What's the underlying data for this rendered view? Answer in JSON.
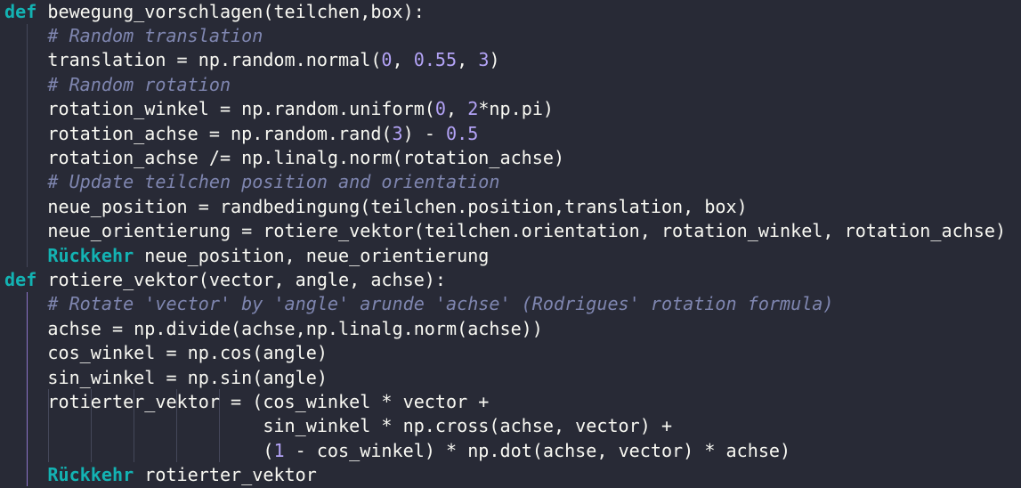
{
  "editor": {
    "lines": [
      [
        {
          "t": "def",
          "c": "kw"
        },
        {
          "t": " bewegung_vorschlagen(teilchen,box):",
          "c": "op"
        }
      ],
      [
        {
          "t": "    "
        },
        {
          "t": "# Random translation",
          "c": "cm"
        }
      ],
      [
        {
          "t": "    translation = np.random.normal("
        },
        {
          "t": "0",
          "c": "num"
        },
        {
          "t": ", "
        },
        {
          "t": "0.55",
          "c": "num"
        },
        {
          "t": ", "
        },
        {
          "t": "3",
          "c": "num"
        },
        {
          "t": ")"
        }
      ],
      [
        {
          "t": "    "
        },
        {
          "t": "# Random rotation",
          "c": "cm"
        }
      ],
      [
        {
          "t": "    rotation_winkel = np.random.uniform("
        },
        {
          "t": "0",
          "c": "num"
        },
        {
          "t": ", "
        },
        {
          "t": "2",
          "c": "num"
        },
        {
          "t": "*np.pi)"
        }
      ],
      [
        {
          "t": "    rotation_achse = np.random.rand("
        },
        {
          "t": "3",
          "c": "num"
        },
        {
          "t": ") - "
        },
        {
          "t": "0.5",
          "c": "num"
        }
      ],
      [
        {
          "t": "    rotation_achse /= np.linalg.norm(rotation_achse)"
        }
      ],
      [
        {
          "t": "    "
        },
        {
          "t": "# Update teilchen position and orientation",
          "c": "cm"
        }
      ],
      [
        {
          "t": "    neue_position = randbedingung(teilchen.position,translation, box)"
        }
      ],
      [
        {
          "t": "    neue_orientierung = rotiere_vektor(teilchen.orientation, rotation_winkel, rotation_achse)"
        }
      ],
      [
        {
          "t": "    "
        },
        {
          "t": "Rückkehr",
          "c": "kw"
        },
        {
          "t": " neue_position, neue_orientierung"
        }
      ],
      [
        {
          "t": "def",
          "c": "kw"
        },
        {
          "t": " rotiere_vektor(vector, angle, achse):"
        }
      ],
      [
        {
          "t": "    "
        },
        {
          "t": "# Rotate 'vector' by 'angle' arunde 'achse' (Rodrigues' rotation formula)",
          "c": "cm"
        }
      ],
      [
        {
          "t": "    achse = np.divide(achse,np.linalg.norm(achse))"
        }
      ],
      [
        {
          "t": "    cos_winkel = np.cos(angle)"
        }
      ],
      [
        {
          "t": "    sin_winkel = np.sin(angle)"
        }
      ],
      [
        {
          "t": "    rotierter_vektor = (cos_winkel * vector +"
        }
      ],
      [
        {
          "t": "                        sin_winkel * np.cross(achse, vector) +"
        }
      ],
      [
        {
          "t": "                        ("
        },
        {
          "t": "1",
          "c": "num"
        },
        {
          "t": " - cos_winkel) * np.dot(achse, vector) * achse)"
        }
      ],
      [
        {
          "t": "    "
        },
        {
          "t": "Rückkehr",
          "c": "kw"
        },
        {
          "t": " rotierter_vektor"
        }
      ]
    ]
  },
  "theme": {
    "background": "#282a36",
    "keyword": "#13b3b3",
    "number": "#b3a3f6",
    "comment": "#7f86b0",
    "text": "#f8f8f2"
  }
}
